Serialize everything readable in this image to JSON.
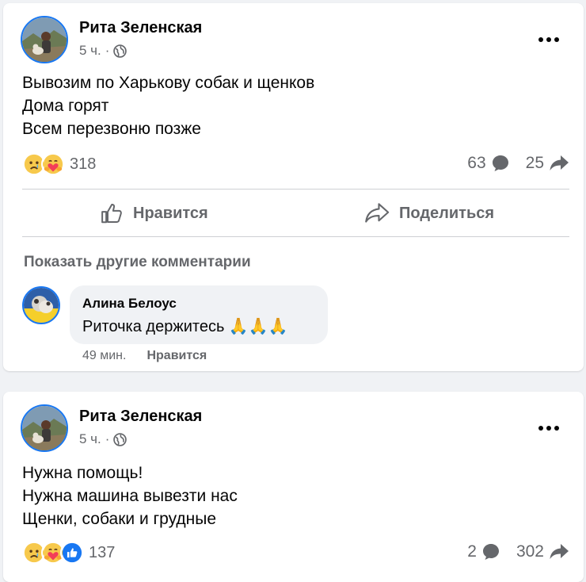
{
  "posts": [
    {
      "author": "Рита Зеленская",
      "time": "5 ч.",
      "separator": "·",
      "lines": [
        "Вывозим по Харькову собак и щенков",
        "Дома горят",
        "Всем перезвоню позже"
      ],
      "reaction_count": "318",
      "reaction_icons": [
        "sad-emoji-icon",
        "care-emoji-icon"
      ],
      "comment_count": "63",
      "share_count": "25",
      "like_label": "Нравится",
      "share_label": "Поделиться",
      "more_comments_label": "Показать другие комментарии",
      "comment": {
        "author": "Алина Белоус",
        "text": "Риточка держитесь 🙏🙏🙏",
        "time": "49 мин.",
        "like_label": "Нравится"
      }
    },
    {
      "author": "Рита Зеленская",
      "time": "5 ч.",
      "separator": "·",
      "lines": [
        "Нужна помощь!",
        "Нужна машина вывезти нас",
        "Щенки, собаки и грудные"
      ],
      "reaction_count": "137",
      "reaction_icons": [
        "sad-emoji-icon",
        "care-emoji-icon",
        "like-icon"
      ],
      "comment_count": "2",
      "share_count": "302"
    }
  ],
  "colors": {
    "background": "#f0f2f5",
    "card": "#ffffff",
    "secondary_text": "#65676b",
    "accent": "#1877f2"
  }
}
